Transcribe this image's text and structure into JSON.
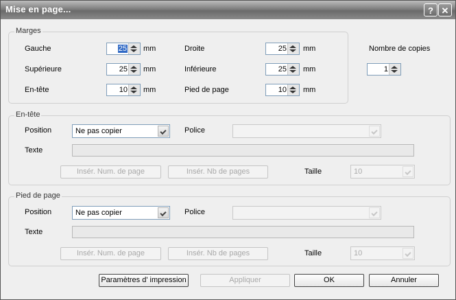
{
  "window": {
    "title": "Mise en page...",
    "help_label": "?",
    "close_label": "✕"
  },
  "marges": {
    "legend": "Marges",
    "gauche": {
      "label": "Gauche",
      "value": "25",
      "unit": "mm"
    },
    "superieure": {
      "label": "Supérieure",
      "value": "25",
      "unit": "mm"
    },
    "entete": {
      "label": "En-tête",
      "value": "10",
      "unit": "mm"
    },
    "droite": {
      "label": "Droite",
      "value": "25",
      "unit": "mm"
    },
    "inferieure": {
      "label": "Inférieure",
      "value": "25",
      "unit": "mm"
    },
    "pied": {
      "label": "Pied de page",
      "value": "10",
      "unit": "mm"
    }
  },
  "copies": {
    "label": "Nombre de copies",
    "value": "1"
  },
  "header": {
    "legend": "En-tête",
    "position_label": "Position",
    "position_value": "Ne pas copier",
    "police_label": "Police",
    "police_value": "",
    "texte_label": "Texte",
    "insert_page_num": "Insér. Num. de page",
    "insert_page_count": "Insér. Nb de pages",
    "taille_label": "Taille",
    "taille_value": "10"
  },
  "footer": {
    "legend": "Pied de page",
    "position_label": "Position",
    "position_value": "Ne pas copier",
    "police_label": "Police",
    "police_value": "",
    "texte_label": "Texte",
    "insert_page_num": "Insér. Num. de page",
    "insert_page_count": "Insér. Nb de pages",
    "taille_label": "Taille",
    "taille_value": "10"
  },
  "buttons": {
    "print_params": "Paramètres d' impression",
    "apply": "Appliquer",
    "ok": "OK",
    "cancel": "Annuler"
  }
}
